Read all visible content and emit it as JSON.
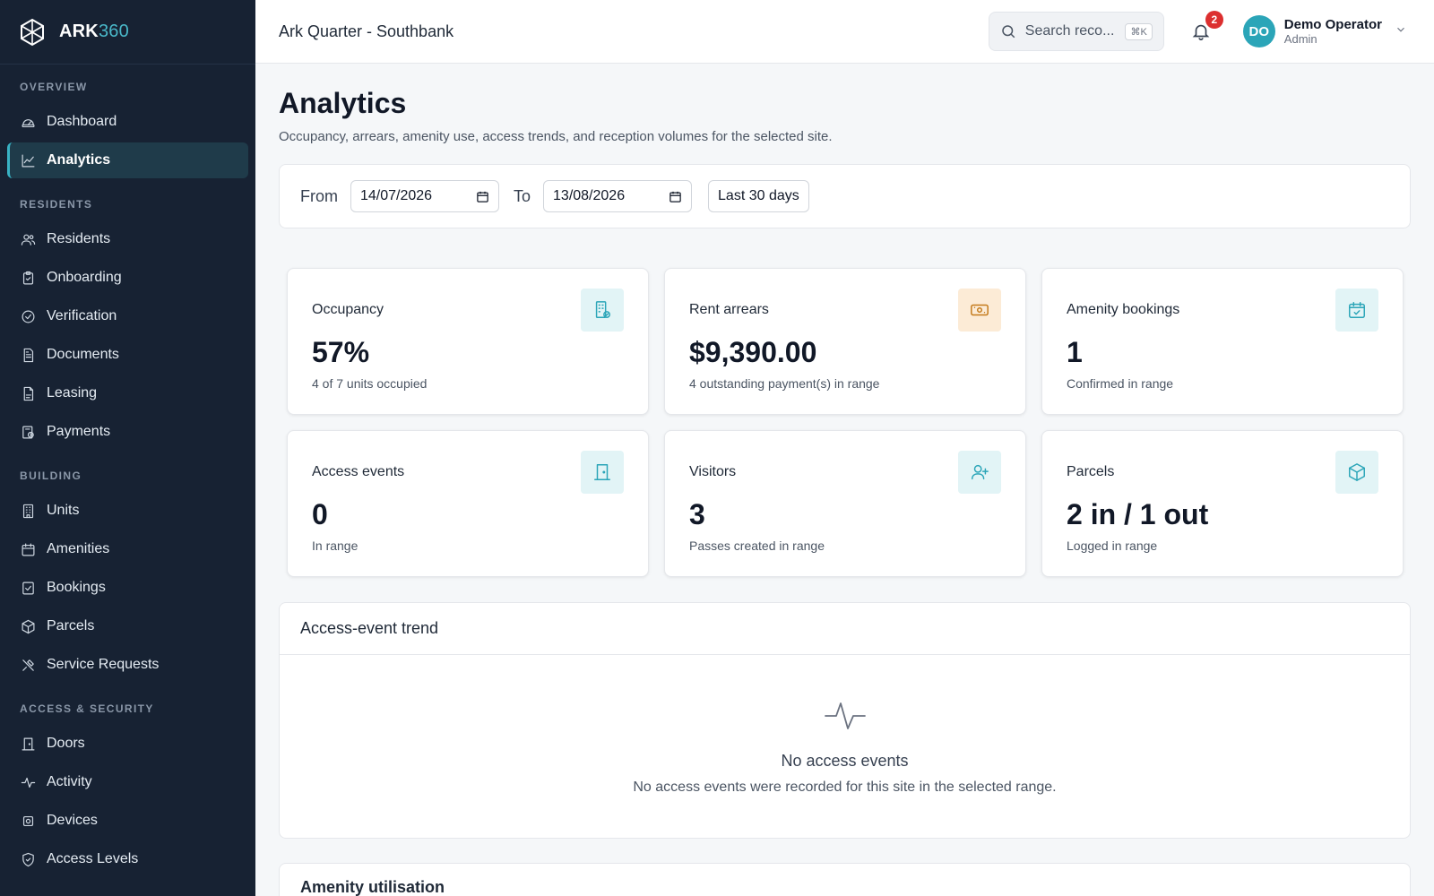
{
  "brand": {
    "name": "ARK",
    "accent": "360"
  },
  "sidebar": {
    "sections": [
      {
        "heading": "OVERVIEW",
        "items": [
          {
            "label": "Dashboard",
            "icon": "gauge-icon"
          },
          {
            "label": "Analytics",
            "icon": "chart-line-icon",
            "active": true
          }
        ]
      },
      {
        "heading": "RESIDENTS",
        "items": [
          {
            "label": "Residents",
            "icon": "users-icon"
          },
          {
            "label": "Onboarding",
            "icon": "clipboard-icon"
          },
          {
            "label": "Verification",
            "icon": "check-circle-icon"
          },
          {
            "label": "Documents",
            "icon": "document-icon"
          },
          {
            "label": "Leasing",
            "icon": "file-icon"
          },
          {
            "label": "Payments",
            "icon": "receipt-icon"
          }
        ]
      },
      {
        "heading": "BUILDING",
        "items": [
          {
            "label": "Units",
            "icon": "building-icon"
          },
          {
            "label": "Amenities",
            "icon": "calendar-icon"
          },
          {
            "label": "Bookings",
            "icon": "calendar-check-icon"
          },
          {
            "label": "Parcels",
            "icon": "package-icon"
          },
          {
            "label": "Service Requests",
            "icon": "tools-icon"
          }
        ]
      },
      {
        "heading": "ACCESS & SECURITY",
        "items": [
          {
            "label": "Doors",
            "icon": "door-icon"
          },
          {
            "label": "Activity",
            "icon": "pulse-icon"
          },
          {
            "label": "Devices",
            "icon": "chip-icon"
          },
          {
            "label": "Access Levels",
            "icon": "shield-icon"
          }
        ]
      }
    ]
  },
  "header": {
    "site": "Ark Quarter - Southbank",
    "search_placeholder": "Search reco...",
    "search_shortcut": "⌘K",
    "notifications": "2",
    "user_initials": "DO",
    "user_name": "Demo Operator",
    "user_role": "Admin"
  },
  "page": {
    "title": "Analytics",
    "subtitle": "Occupancy, arrears, amenity use, access trends, and reception volumes for the selected site."
  },
  "filters": {
    "from_label": "From",
    "from_value": "14/07/2026",
    "to_label": "To",
    "to_value": "13/08/2026",
    "preset_label": "Last 30 days"
  },
  "cards": [
    {
      "title": "Occupancy",
      "value": "57%",
      "note": "4 of 7 units occupied",
      "icon": "building-check-icon"
    },
    {
      "title": "Rent arrears",
      "value": "$9,390.00",
      "note": "4 outstanding payment(s) in range",
      "icon": "cash-icon"
    },
    {
      "title": "Amenity bookings",
      "value": "1",
      "note": "Confirmed in range",
      "icon": "calendar-check-icon"
    },
    {
      "title": "Access events",
      "value": "0",
      "note": "In range",
      "icon": "door-icon"
    },
    {
      "title": "Visitors",
      "value": "3",
      "note": "Passes created in range",
      "icon": "user-plus-icon"
    },
    {
      "title": "Parcels",
      "value": "2 in / 1 out",
      "note": "Logged in range",
      "icon": "package-icon"
    }
  ],
  "trend": {
    "title": "Access-event trend",
    "empty_title": "No access events",
    "empty_text": "No access events were recorded for this site in the selected range."
  },
  "next_section_title": "Amenity utilisation",
  "colors": {
    "sidebar_bg": "#172233",
    "accent": "#2ba5b8",
    "badge": "#dc2f2f",
    "arrears_icon_bg": "#fcebd6"
  }
}
